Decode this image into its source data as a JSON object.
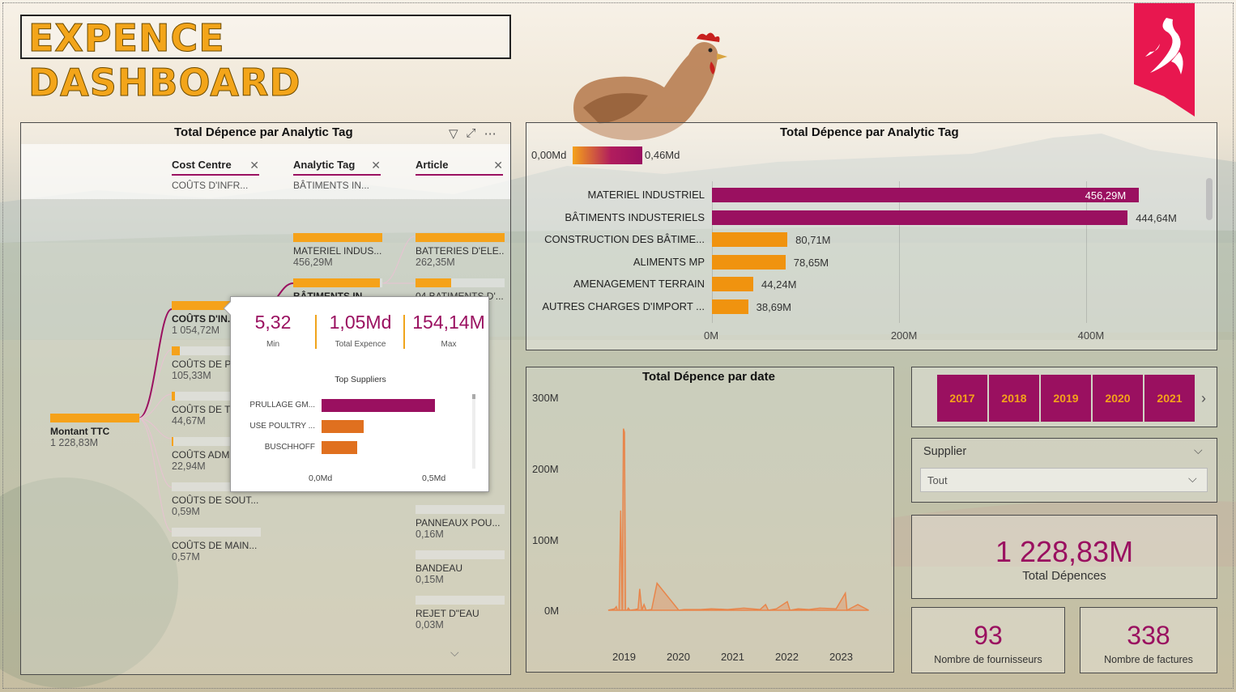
{
  "title": "EXPENCE DASHBOARD",
  "decomposition_tree": {
    "title": "Total Dépence par Analytic Tag",
    "levels": [
      {
        "name": "Cost Centre",
        "value": "COÛTS D'INFR..."
      },
      {
        "name": "Analytic Tag",
        "value": "BÂTIMENTS IN..."
      },
      {
        "name": "Article",
        "value": ""
      }
    ],
    "root": {
      "label": "Montant TTC",
      "value": "1 228,83M",
      "fill": 1.0
    },
    "cost_centres": [
      {
        "label": "COÛTS D'IN...",
        "value": "1 054,72M",
        "fill": 0.86
      },
      {
        "label": "COÛTS DE P...",
        "value": "105,33M",
        "fill": 0.09
      },
      {
        "label": "COÛTS DE T...",
        "value": "44,67M",
        "fill": 0.04
      },
      {
        "label": "COÛTS ADM...",
        "value": "22,94M",
        "fill": 0.02
      },
      {
        "label": "COÛTS DE SOUT...",
        "value": "0,59M",
        "fill": 0.0
      },
      {
        "label": "COÛTS DE MAIN...",
        "value": "0,57M",
        "fill": 0.0
      }
    ],
    "analytic_tags": [
      {
        "label": "MATERIEL INDUS...",
        "value": "456,29M",
        "fill": 1.0
      },
      {
        "label": "BÂTIMENTS IN...",
        "value": "",
        "fill": 0.97
      }
    ],
    "articles": [
      {
        "label": "BATTERIES D'ELE...",
        "value": "262,35M",
        "fill": 1.0
      },
      {
        "label": "04 BATIMENTS D'...",
        "value": "",
        "fill": 0.4
      },
      {
        "label": "PANNEAUX POU...",
        "value": "0,16M",
        "fill": 0.0
      },
      {
        "label": "BANDEAU",
        "value": "0,15M",
        "fill": 0.0
      },
      {
        "label": "REJET D\"EAU",
        "value": "0,03M",
        "fill": 0.0
      }
    ]
  },
  "tooltip": {
    "kpis": [
      {
        "value": "5,32",
        "caption": "Min"
      },
      {
        "value": "1,05Md",
        "caption": "Total Expence"
      },
      {
        "value": "154,14M",
        "caption": "Max"
      }
    ],
    "subtitle": "Top Suppliers",
    "suppliers": [
      {
        "name": "PRULLAGE GM...",
        "value": 0.5,
        "color": "#9a1060"
      },
      {
        "name": "USE POULTRY ...",
        "value": 0.185,
        "color": "#e0701f"
      },
      {
        "name": "BUSCHHOFF",
        "value": 0.158,
        "color": "#e0701f"
      }
    ],
    "axis": {
      "min_label": "0,0Md",
      "max_label": "0,5Md",
      "max": 0.5
    }
  },
  "bar_chart": {
    "title": "Total Dépence par Analytic Tag",
    "legend": {
      "min": "0,00Md",
      "max": "0,46Md"
    },
    "colors": {
      "high": "#9a1060",
      "low": "#f0930f"
    }
  },
  "line_chart": {
    "title": "Total Dépence par date",
    "y_ticks": [
      "300M",
      "200M",
      "100M",
      "0M"
    ],
    "x_ticks": [
      "2019",
      "2020",
      "2021",
      "2022",
      "2023"
    ],
    "color": "#e8854a"
  },
  "chart_data": [
    {
      "type": "bar",
      "orientation": "horizontal",
      "title": "Total Dépence par Analytic Tag",
      "categories": [
        "MATERIEL INDUSTRIEL",
        "BÂTIMENTS INDUSTERIELS",
        "CONSTRUCTION DES BÂTIME...",
        "ALIMENTS MP",
        "AMENAGEMENT TERRAIN",
        "AUTRES CHARGES D'IMPORT ..."
      ],
      "values": [
        456.29,
        444.64,
        80.71,
        78.65,
        44.24,
        38.69
      ],
      "value_labels": [
        "456,29M",
        "444,64M",
        "80,71M",
        "78,65M",
        "44,24M",
        "38,69M"
      ],
      "x_ticks": [
        "0M",
        "200M",
        "400M"
      ],
      "xlim": [
        0,
        480
      ],
      "legend": "top-left"
    },
    {
      "type": "area",
      "title": "Total Dépence par date",
      "ylim": [
        0,
        300
      ],
      "x_ticks": [
        "2019",
        "2020",
        "2021",
        "2022",
        "2023"
      ],
      "series": [
        {
          "x": [
            2018.7,
            2018.82,
            2018.85,
            2018.87,
            2018.9,
            2018.93,
            2018.96,
            2018.98,
            2019.0,
            2019.02,
            2019.05,
            2019.07,
            2019.1,
            2019.2,
            2019.25,
            2019.28,
            2019.32,
            2019.36,
            2019.4,
            2019.5,
            2019.6,
            2020.0,
            2020.1,
            2020.4,
            2020.6,
            2020.9,
            2021.2,
            2021.5,
            2021.6,
            2021.65,
            2021.8,
            2022.0,
            2022.05,
            2022.2,
            2022.4,
            2022.6,
            2022.9,
            2023.07,
            2023.1,
            2023.3,
            2023.5
          ],
          "y": [
            0,
            2,
            5,
            0,
            0,
            140,
            0,
            255,
            250,
            0,
            0,
            3,
            0,
            1,
            2,
            30,
            0,
            8,
            0,
            1,
            38,
            0,
            1,
            1,
            2,
            1,
            3,
            1,
            8,
            0,
            2,
            12,
            0,
            2,
            1,
            3,
            2,
            24,
            0,
            8,
            0
          ]
        }
      ]
    }
  ],
  "year_slicer": {
    "years": [
      "2017",
      "2018",
      "2019",
      "2020",
      "2021"
    ]
  },
  "supplier_slicer": {
    "title": "Supplier",
    "value": "Tout"
  },
  "cards": {
    "total": {
      "value": "1 228,83M",
      "caption": "Total Dépences"
    },
    "suppliers": {
      "value": "93",
      "caption": "Nombre de fournisseurs"
    },
    "invoices": {
      "value": "338",
      "caption": "Nombre de factures"
    }
  }
}
